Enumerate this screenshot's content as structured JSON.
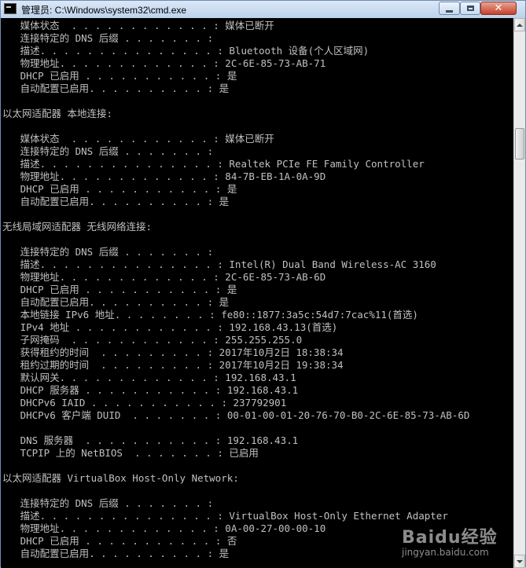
{
  "window": {
    "title": "管理员: C:\\Windows\\system32\\cmd.exe"
  },
  "console": {
    "lines": [
      "   媒体状态  . . . . . . . . . . . . : 媒体已断开",
      "   连接特定的 DNS 后缀 . . . . . . . : ",
      "   描述. . . . . . . . . . . . . . . : Bluetooth 设备(个人区域网)",
      "   物理地址. . . . . . . . . . . . . : 2C-6E-85-73-AB-71",
      "   DHCP 已启用 . . . . . . . . . . . : 是",
      "   自动配置已启用. . . . . . . . . . : 是",
      "",
      "以太网适配器 本地连接:",
      "",
      "   媒体状态  . . . . . . . . . . . . : 媒体已断开",
      "   连接特定的 DNS 后缀 . . . . . . . : ",
      "   描述. . . . . . . . . . . . . . . : Realtek PCIe FE Family Controller",
      "   物理地址. . . . . . . . . . . . . : 84-7B-EB-1A-0A-9D",
      "   DHCP 已启用 . . . . . . . . . . . : 是",
      "   自动配置已启用. . . . . . . . . . : 是",
      "",
      "无线局域网适配器 无线网络连接:",
      "",
      "   连接特定的 DNS 后缀 . . . . . . . : ",
      "   描述. . . . . . . . . . . . . . . : Intel(R) Dual Band Wireless-AC 3160",
      "   物理地址. . . . . . . . . . . . . : 2C-6E-85-73-AB-6D",
      "   DHCP 已启用 . . . . . . . . . . . : 是",
      "   自动配置已启用. . . . . . . . . . : 是",
      "   本地链接 IPv6 地址. . . . . . . . : fe80::1877:3a5c:54d7:7cac%11(首选)",
      "   IPv4 地址 . . . . . . . . . . . . : 192.168.43.13(首选)",
      "   子网掩码  . . . . . . . . . . . . : 255.255.255.0",
      "   获得租约的时间  . . . . . . . . . : 2017年10月2日 18:38:34",
      "   租约过期的时间  . . . . . . . . . : 2017年10月2日 19:38:34",
      "   默认网关. . . . . . . . . . . . . : 192.168.43.1",
      "   DHCP 服务器 . . . . . . . . . . . : 192.168.43.1",
      "   DHCPv6 IAID . . . . . . . . . . . : 237792901",
      "   DHCPv6 客户端 DUID  . . . . . . . : 00-01-00-01-20-76-70-B0-2C-6E-85-73-AB-6D",
      "",
      "   DNS 服务器  . . . . . . . . . . . : 192.168.43.1",
      "   TCPIP 上的 NetBIOS  . . . . . . . : 已启用",
      "",
      "以太网适配器 VirtualBox Host-Only Network:",
      "",
      "   连接特定的 DNS 后缀 . . . . . . . : ",
      "   描述. . . . . . . . . . . . . . . : VirtualBox Host-Only Ethernet Adapter",
      "   物理地址. . . . . . . . . . . . . : 0A-00-27-00-00-10",
      "   DHCP 已启用 . . . . . . . . . . . : 否",
      "   自动配置已启用. . . . . . . . . . : 是"
    ]
  },
  "watermark": {
    "logo": "Baidu经验",
    "url": "jingyan.baidu.com"
  }
}
